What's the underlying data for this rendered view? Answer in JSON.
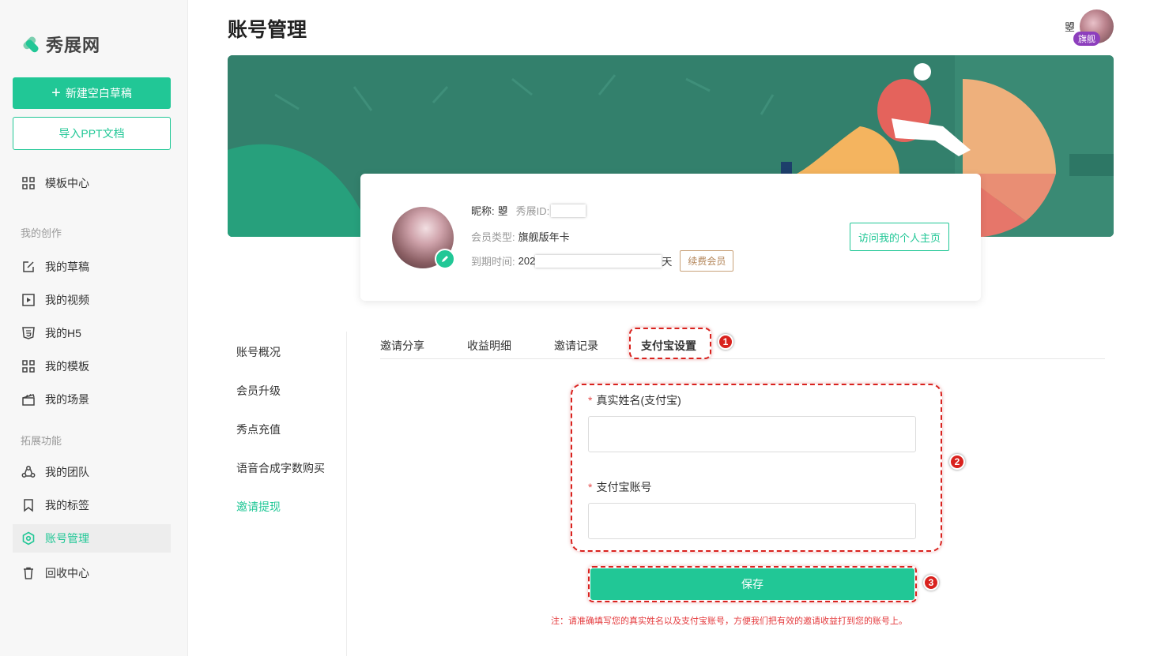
{
  "app": {
    "logo_text": "秀展网",
    "page_title": "账号管理"
  },
  "sidebar": {
    "new_button": "新建空白草稿",
    "import_button": "导入PPT文档",
    "template_center": "模板中心",
    "group_creation": "我的创作",
    "group_extend": "拓展功能",
    "items": [
      {
        "label": "我的草稿"
      },
      {
        "label": "我的视频"
      },
      {
        "label": "我的H5"
      },
      {
        "label": "我的模板"
      },
      {
        "label": "我的场景"
      },
      {
        "label": "我的团队"
      },
      {
        "label": "我的标签"
      },
      {
        "label": "账号管理"
      },
      {
        "label": "回收中心"
      }
    ],
    "active_item": "账号管理"
  },
  "header": {
    "user_name": "曌",
    "vip_badge": "旗舰"
  },
  "profile": {
    "nickname_label": "昵称:",
    "nickname": "曌",
    "id_label": "秀展ID:",
    "member_type_label": "会员类型:",
    "member_type": "旗舰版年卡",
    "expiry_label": "到期时间:",
    "expiry_prefix": "202",
    "expiry_suffix": "天",
    "renew_button": "续费会员",
    "visit_button": "访问我的个人主页"
  },
  "account_menu": {
    "items": [
      "账号概况",
      "会员升级",
      "秀点充值",
      "语音合成字数购买",
      "邀请提现"
    ],
    "active": "邀请提现"
  },
  "tabs": {
    "items": [
      "邀请分享",
      "收益明细",
      "邀请记录",
      "支付宝设置"
    ],
    "active": "支付宝设置"
  },
  "form": {
    "name_label": "真实姓名(支付宝)",
    "name_value": "",
    "account_label": "支付宝账号",
    "account_value": "",
    "save_button": "保存",
    "note": "注：请准确填写您的真实姓名以及支付宝账号，方便我们把有效的邀请收益打到您的账号上。"
  },
  "annotations": {
    "step1": "1",
    "step2": "2",
    "step3": "3"
  },
  "colors": {
    "accent": "#21c796",
    "annotation_red": "#d9221e",
    "banner_green": "#33806c",
    "vip_purple": "#8d3fbd"
  }
}
